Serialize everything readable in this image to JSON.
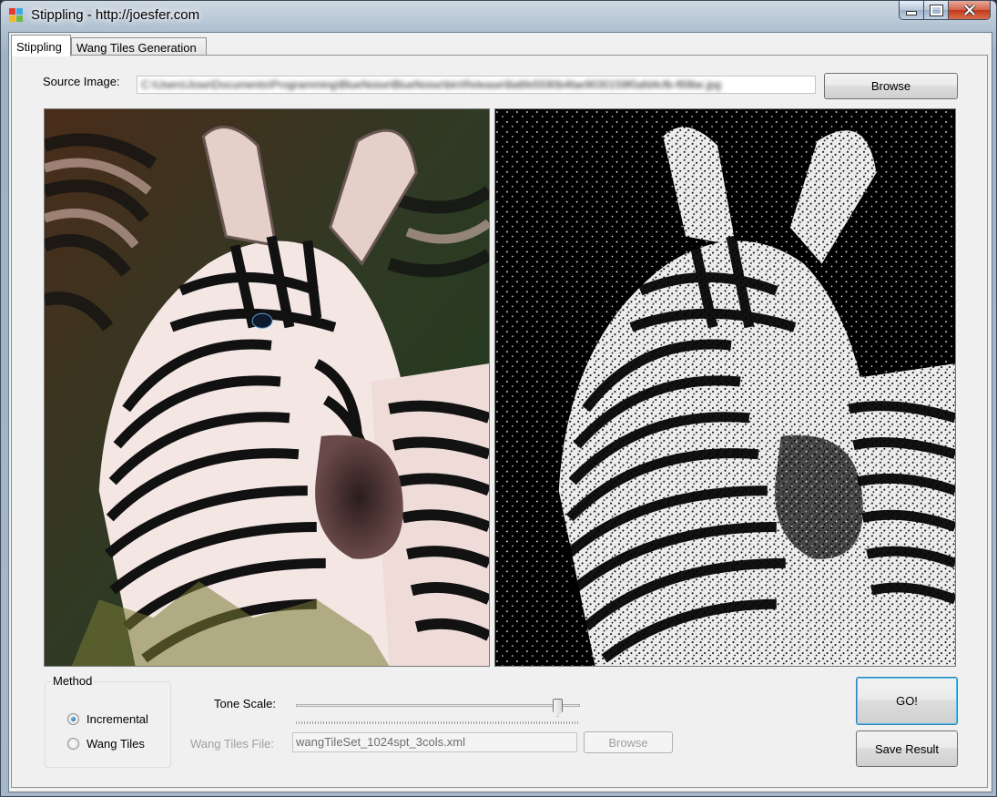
{
  "window": {
    "title": "Stippling - http://joesfer.com",
    "caption_icons": [
      "minimize-icon",
      "maximize-icon",
      "close-icon"
    ]
  },
  "tabs": [
    {
      "label": "Stippling",
      "active": true
    },
    {
      "label": "Wang Tiles Generation",
      "active": false
    }
  ],
  "source": {
    "label": "Source Image:",
    "path": "C:\\Users\\Jose\\Documents\\Programming\\BlueNoise\\BlueNoise\\bin\\Release\\8a6fe5590b4fae9030159f0afd4cfb-f69be.jpg",
    "browse_label": "Browse"
  },
  "images": {
    "source_alt": "zebra photo",
    "result_alt": "stippled zebra"
  },
  "method": {
    "legend": "Method",
    "options": [
      {
        "label": "Incremental",
        "checked": true
      },
      {
        "label": "Wang Tiles",
        "checked": false
      }
    ]
  },
  "tone_scale": {
    "label": "Tone Scale:",
    "value_fraction": 0.92
  },
  "wang_tiles_file": {
    "label": "Wang Tiles File:",
    "value": "wangTileSet_1024spt_3cols.xml",
    "browse_label": "Browse",
    "enabled": false
  },
  "actions": {
    "go_label": "GO!",
    "save_label": "Save Result"
  },
  "colors": {
    "accent_focus": "#49c0ee",
    "title_close": "#c1381a"
  }
}
